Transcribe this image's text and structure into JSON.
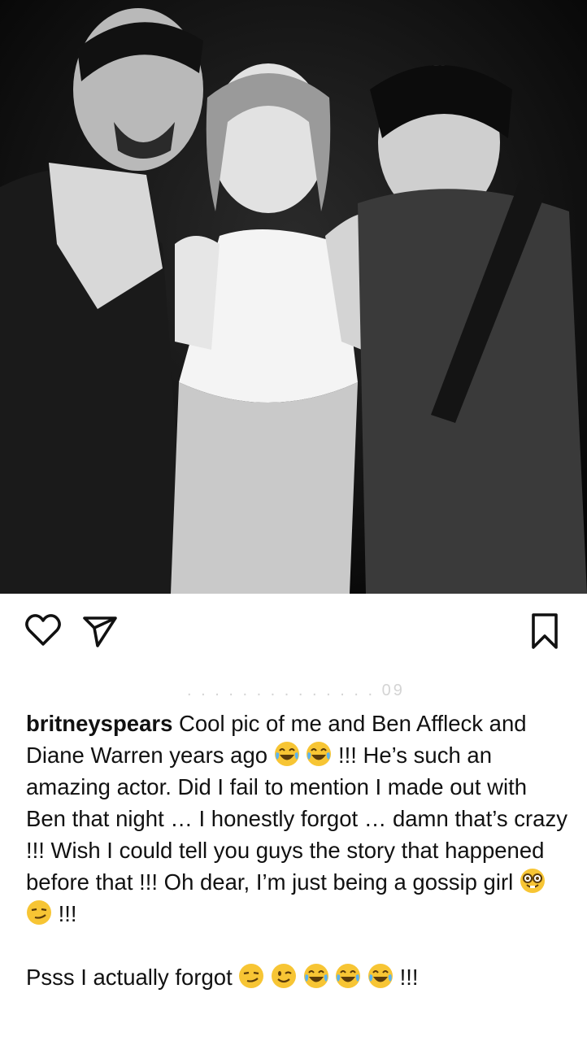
{
  "post": {
    "image": {
      "description_icon": "photo-icon"
    },
    "actions": {
      "like_icon": "heart-icon",
      "share_icon": "paper-plane-icon",
      "save_icon": "bookmark-icon"
    },
    "faint_text": "09",
    "caption": {
      "username": "britneyspears",
      "text_1": "Cool pic of me and Ben Affleck and Diane Warren years ago",
      "text_2": "!!! He’s such an amazing actor. Did I fail to mention I made out with Ben that night … I honestly forgot … damn that’s crazy !!! Wish I could tell you guys the story that happened before that !!! Oh dear, I’m just being a gossip girl",
      "text_3": "!!!",
      "ps_text": "Psss I actually forgot",
      "ps_end": "!!!"
    }
  },
  "colors": {
    "text": "#111111",
    "background": "#ffffff",
    "emoji_yellow": "#F7C534"
  }
}
